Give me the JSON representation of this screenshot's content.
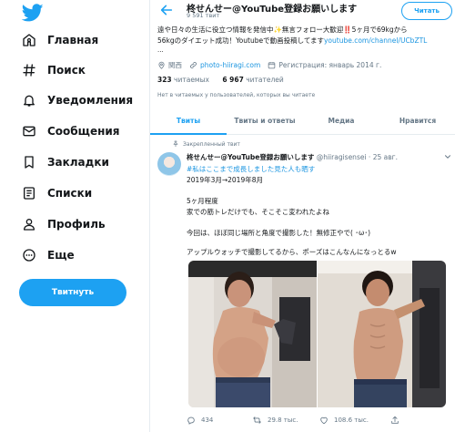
{
  "sidebar": {
    "items": [
      {
        "label": "Главная",
        "icon": "home-icon"
      },
      {
        "label": "Поиск",
        "icon": "hashtag-icon"
      },
      {
        "label": "Уведомления",
        "icon": "bell-icon"
      },
      {
        "label": "Сообщения",
        "icon": "mail-icon"
      },
      {
        "label": "Закладки",
        "icon": "bookmark-icon"
      },
      {
        "label": "Списки",
        "icon": "list-icon"
      },
      {
        "label": "Профиль",
        "icon": "person-icon"
      },
      {
        "label": "Еще",
        "icon": "more-icon"
      }
    ],
    "tweet_button": "Твитнуть"
  },
  "header": {
    "name": "柊せんせー@YouTube登録お願いします",
    "tweet_count": "9 591 твит",
    "follow_label": "Читать"
  },
  "profile": {
    "bio_line1": "遠や日々の生活に役立つ情報を発信中✨無言フォロー大歓迎‼️5ヶ月で69kgから",
    "bio_line2_text": "56kgのダイエット成功！Youtubeで動画投稿してます",
    "bio_line2_link": "youtube.com/channel/UCbZTL",
    "bio_more": "...",
    "location": "関西",
    "website": "photo-hiiragi.com",
    "joined": "Регистрация: январь 2014 г.",
    "following_count": "323",
    "following_label": "читаемых",
    "followers_count": "6 967",
    "followers_label": "читателей",
    "known_followers": "Нет в читаемых у пользователей, которых вы читаете"
  },
  "tabs": [
    {
      "label": "Твиты",
      "active": true
    },
    {
      "label": "Твиты и ответы",
      "active": false
    },
    {
      "label": "Медиа",
      "active": false
    },
    {
      "label": "Нравится",
      "active": false
    }
  ],
  "tweet": {
    "pinned_label": "Закрепленный твит",
    "author": "柊せんせー@YouTube登録お願いします",
    "handle_date": "@hiiragisensei · 25 авг.",
    "hashtag": "#私はここまで成長しました見た人も晒す",
    "lines": [
      "2019年3月→2019年8月",
      "",
      "5ヶ月程度",
      "家での筋トレだけでも、そこそこ変われたよね",
      "",
      "今回は、ほぼ同じ場所と角度で撮影した！無修正やで( ･ω･)",
      "",
      "アップルウォッチで撮影してるから、ポーズはこんなんになっとるw"
    ],
    "replies": "434",
    "retweets": "29.8 тыс.",
    "likes": "108.6 тыс."
  },
  "colors": {
    "accent": "#1da1f2",
    "link": "#1b95e0",
    "secondary_text": "#657786",
    "border": "#e6ecf0"
  }
}
